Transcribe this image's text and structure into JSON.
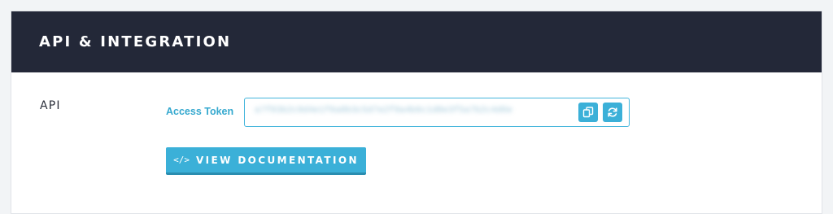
{
  "header": {
    "title": "API & INTEGRATION"
  },
  "api_section": {
    "label": "API",
    "access_token": {
      "label": "Access Token",
      "value": "a7f83b2c9d4e1f6a8b3c5d7e2f9a4b6c1d8e3f5a7b2c4d6e"
    },
    "copy_icon": "copy-icon",
    "refresh_icon": "refresh-icon",
    "doc_button": {
      "icon": "code-icon",
      "icon_glyph": "</>",
      "label": "VIEW DOCUMENTATION"
    }
  },
  "colors": {
    "header_bg": "#232838",
    "accent": "#3bb0d8",
    "label": "#36a9cf"
  }
}
